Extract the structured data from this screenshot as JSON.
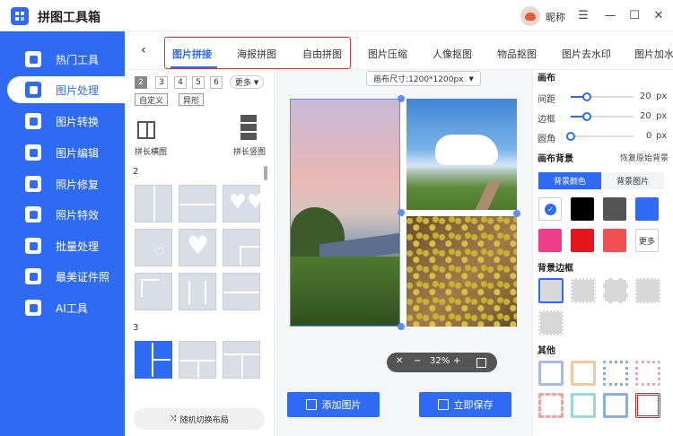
{
  "app": {
    "title": "拼图工具箱",
    "nickname": "昵称"
  },
  "sidebar": {
    "items": [
      {
        "label": "热门工具"
      },
      {
        "label": "图片处理"
      },
      {
        "label": "图片转换"
      },
      {
        "label": "图片编辑"
      },
      {
        "label": "照片修复"
      },
      {
        "label": "照片特效"
      },
      {
        "label": "批量处理"
      },
      {
        "label": "最美证件照"
      },
      {
        "label": "AI工具"
      }
    ],
    "active_index": 1
  },
  "tabs": [
    {
      "label": "图片拼接"
    },
    {
      "label": "海报拼图"
    },
    {
      "label": "自由拼图"
    },
    {
      "label": "图片压缩"
    },
    {
      "label": "人像抠图"
    },
    {
      "label": "物品抠图"
    },
    {
      "label": "图片去水印"
    },
    {
      "label": "图片加水"
    }
  ],
  "left": {
    "counts": [
      "2",
      "3",
      "4",
      "5",
      "6"
    ],
    "more": "更多",
    "custom": "自定义",
    "irregular": "异形",
    "horizontal": "拼长横图",
    "vertical": "拼长竖图",
    "section2": "2",
    "section3": "3",
    "random": "随机切换布局"
  },
  "canvas": {
    "size": "画布尺寸:1200*1200px",
    "zoom": "32%"
  },
  "actions": {
    "add": "添加图片",
    "save": "立即保存"
  },
  "right": {
    "canvas_title": "画布",
    "spacing": {
      "label": "间距",
      "value": "20",
      "unit": "px",
      "level": 0.25
    },
    "border": {
      "label": "边框",
      "value": "20",
      "unit": "px",
      "level": 0.25
    },
    "radius": {
      "label": "圆角",
      "value": "0",
      "unit": "px",
      "level": 0.0
    },
    "bg_title": "画布背景",
    "reset": "恢复原始背景",
    "bg_color_tab": "背景颜色",
    "bg_image_tab": "背景图片",
    "colors": [
      "#ffffff",
      "#000000",
      "#555555",
      "#2f6bf2",
      "#f03c8c",
      "#e8141e",
      "#f05050"
    ],
    "more_colors": "更多",
    "border_title": "背景边框",
    "other_title": "其他",
    "accent": "#2f6bf2"
  }
}
